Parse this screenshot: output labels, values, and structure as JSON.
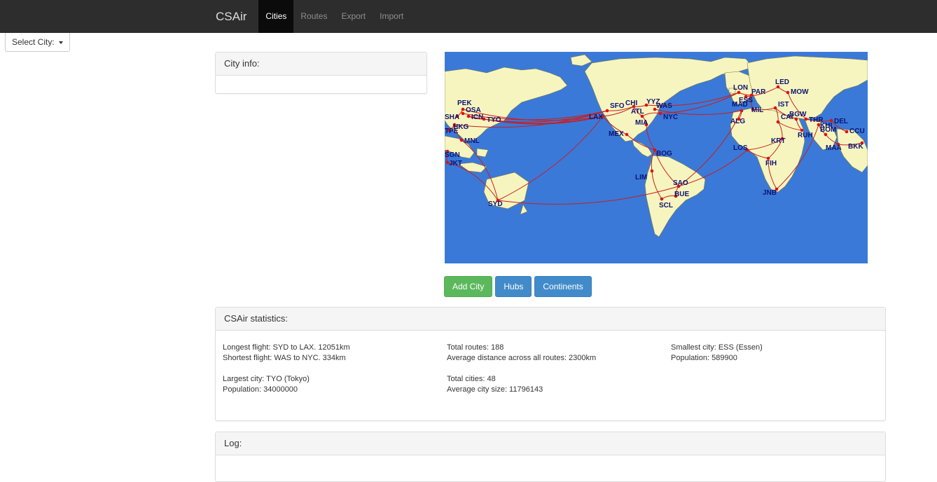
{
  "nav": {
    "brand": "CSAir",
    "tabs": [
      {
        "label": "Cities",
        "active": true
      },
      {
        "label": "Routes"
      },
      {
        "label": "Export"
      },
      {
        "label": "Import"
      }
    ]
  },
  "select_city": {
    "label": "Select City:"
  },
  "city_info": {
    "title": "City info:"
  },
  "map": {
    "ocean_color": "#3a79d8",
    "land_color": "#f7f5bf",
    "route_color": "#c81e1e",
    "city_label_color": "#0c1473",
    "cities": [
      "PEK",
      "OSA",
      "SHA",
      "ICN",
      "TYO",
      "HKG",
      "TPE",
      "MNL",
      "SGN",
      "JKT",
      "SYD",
      "LAX",
      "SFO",
      "CHI",
      "YYZ",
      "WAS",
      "NYC",
      "ATL",
      "MIA",
      "MEX",
      "BOG",
      "LIM",
      "SAO",
      "BUE",
      "SCL",
      "LON",
      "ESS",
      "PAR",
      "LED",
      "MOW",
      "MAD",
      "MIL",
      "IST",
      "ALG",
      "CAI",
      "KRT",
      "BGW",
      "THR",
      "KHI",
      "DEL",
      "RUH",
      "BOM",
      "MAA",
      "CCU",
      "BKK",
      "LOS",
      "FIH",
      "JNB"
    ]
  },
  "buttons": {
    "add_city": "Add City",
    "hubs": "Hubs",
    "continents": "Continents"
  },
  "stats": {
    "title": "CSAir statistics:",
    "longest_flight": "Longest flight: SYD to LAX. 12051km",
    "shortest_flight": "Shortest flight: WAS to NYC. 334km",
    "largest_city": "Largest city: TYO (Tokyo)",
    "largest_population": "Population: 34000000",
    "total_routes": "Total routes: 188",
    "average_distance": "Average distance across all routes: 2300km",
    "total_cities": "Total cities: 48",
    "average_city_size": "Average city size: 11796143",
    "smallest_city": "Smallest city: ESS (Essen)",
    "smallest_population": "Population: 589900"
  },
  "log": {
    "title": "Log:"
  }
}
